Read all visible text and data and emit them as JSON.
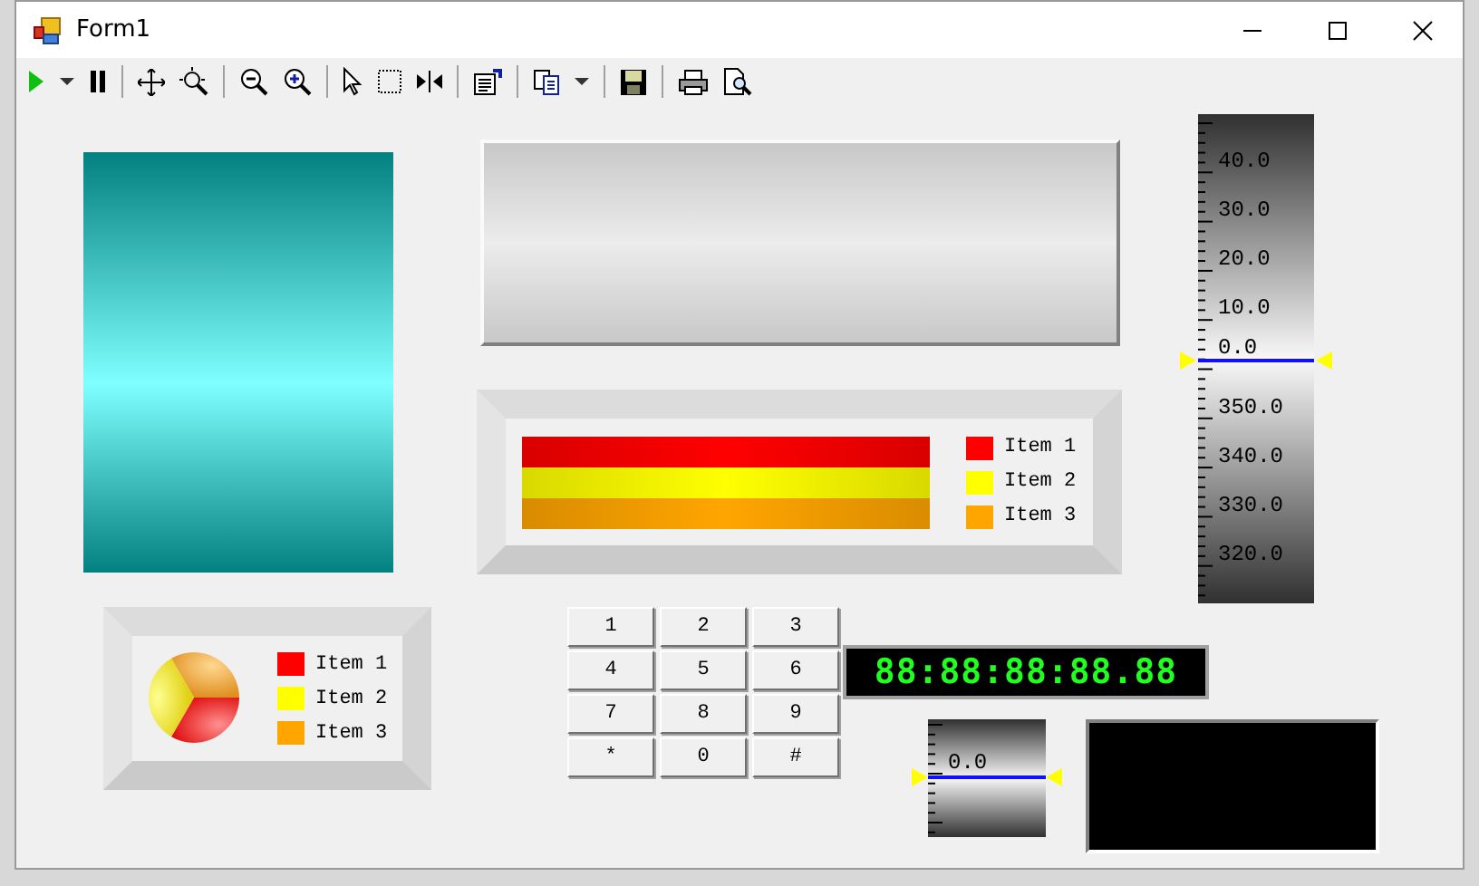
{
  "window": {
    "title": "Form1"
  },
  "scale_gauge": {
    "labels": [
      "40.0",
      "30.0",
      "20.0",
      "10.0",
      "0.0",
      "350.0",
      "340.0",
      "330.0",
      "320.0"
    ]
  },
  "bar_legend": [
    {
      "label": "Item 1",
      "color": "#ff0000"
    },
    {
      "label": "Item 2",
      "color": "#ffff00"
    },
    {
      "label": "Item 3",
      "color": "#ffa500"
    }
  ],
  "pie_legend": [
    {
      "label": "Item 1",
      "color": "#ff0000"
    },
    {
      "label": "Item 2",
      "color": "#ffff00"
    },
    {
      "label": "Item 3",
      "color": "#ffa500"
    }
  ],
  "keypad": [
    "1",
    "2",
    "3",
    "4",
    "5",
    "6",
    "7",
    "8",
    "9",
    "*",
    "0",
    "#"
  ],
  "lcd": {
    "value": "88:88:88:88.88"
  },
  "small_gauge": {
    "label": "0.0"
  }
}
